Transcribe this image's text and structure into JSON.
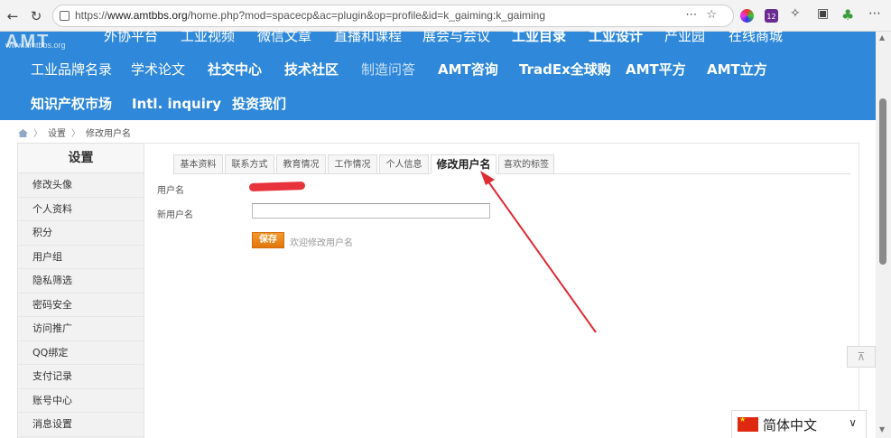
{
  "browser": {
    "url_prefix": "https://",
    "url_host": "www.amtbbs.org",
    "url_path": "/home.php?mod=spacecp&ac=plugin&op=profile&id=k_gaiming:k_gaiming",
    "ext_badge": "12"
  },
  "logo": {
    "big": "AMT",
    "small": "www.amtbbs.org"
  },
  "nav": {
    "row1": [
      "外协平台",
      "工业视频",
      "微信文章",
      "直播和课程",
      "展会与会议",
      "工业目录",
      "工业设计",
      "产业园",
      "在线商城"
    ],
    "row2": [
      "工业品牌名录",
      "学术论文",
      "社交中心",
      "技术社区",
      "制造问答",
      "AMT咨询",
      "TradEx全球购",
      "AMT平方",
      "AMT立方"
    ],
    "row3": [
      "知识产权市场",
      "Intl. inquiry",
      "投资我们"
    ]
  },
  "breadcrumb": {
    "items": [
      "设置",
      "修改用户名"
    ]
  },
  "sidebar": {
    "title": "设置",
    "items": [
      "修改头像",
      "个人资料",
      "积分",
      "用户组",
      "隐私筛选",
      "密码安全",
      "访问推广",
      "QQ绑定",
      "支付记录",
      "账号中心",
      "消息设置"
    ]
  },
  "tabs": [
    "基本资料",
    "联系方式",
    "教育情况",
    "工作情况",
    "个人信息",
    "修改用户名",
    "喜欢的标签"
  ],
  "form": {
    "username_label": "用户名",
    "new_username_label": "新用户名",
    "new_username_value": "",
    "save_label": "保存",
    "hint": "欢迎修改用户名"
  },
  "language": {
    "selected": "简体中文"
  },
  "colors": {
    "header_blue": "#2f88d9",
    "save_orange": "#e8830f",
    "annotation_red": "#e02b35"
  }
}
